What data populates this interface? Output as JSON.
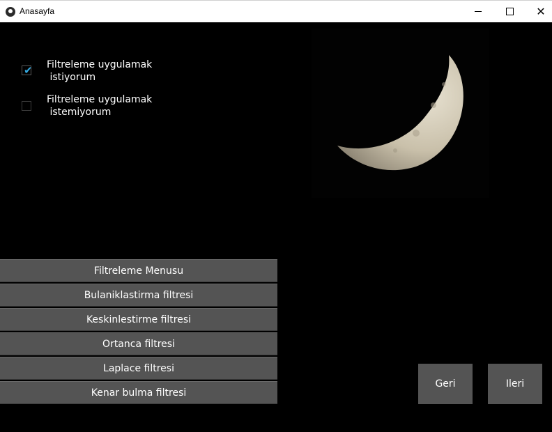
{
  "window": {
    "title": "Anasayfa",
    "icon": "app-icon",
    "controls": [
      "minimize-icon",
      "maximize-icon",
      "close-icon"
    ]
  },
  "options": [
    {
      "label": "Filtreleme uygulamak\n istiyorum",
      "checked": true
    },
    {
      "label": "Filtreleme uygulamak\n istemiyorum",
      "checked": false
    }
  ],
  "menu": {
    "items": [
      "Filtreleme Menusu",
      "Bulaniklastirma filtresi",
      "Keskinlestirme filtresi",
      "Ortanca filtresi",
      "Laplace filtresi",
      "Kenar bulma filtresi"
    ]
  },
  "nav": {
    "back": "Geri",
    "next": "Ileri"
  },
  "colors": {
    "checkbox_accent": "#35a9e0",
    "button_bg": "#545454",
    "background": "#000000"
  }
}
